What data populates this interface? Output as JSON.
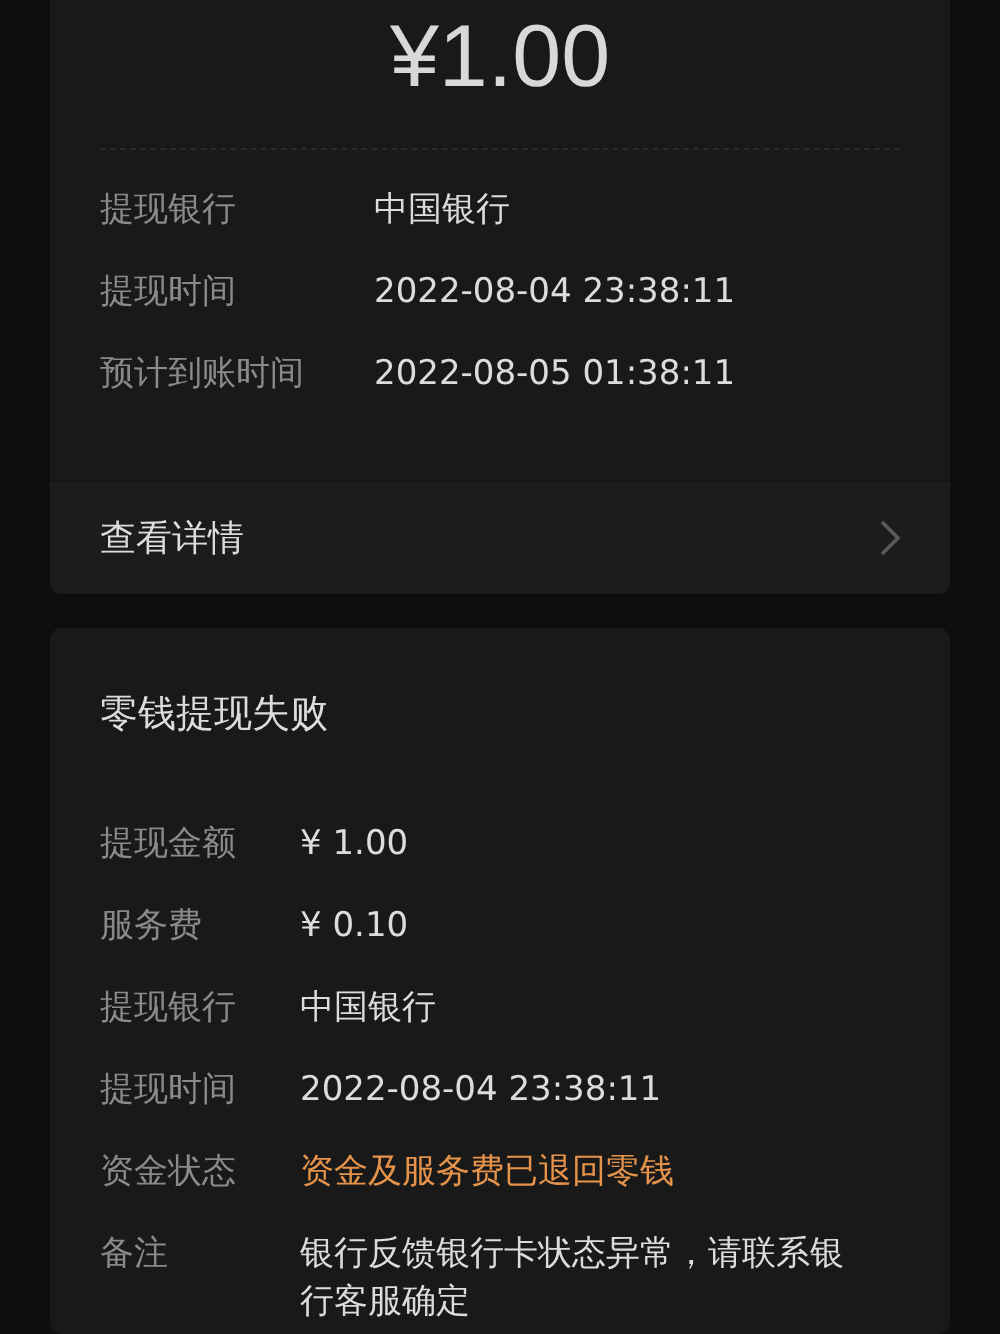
{
  "summary": {
    "amount": "¥1.00",
    "rows": [
      {
        "label": "提现银行",
        "value": "中国银行",
        "kind": "plain"
      },
      {
        "label": "提现时间",
        "value": "2022-08-04 23:38:11",
        "kind": "plain"
      },
      {
        "label": "预计到账时间",
        "value": "2022-08-05 01:38:11",
        "kind": "plain"
      }
    ],
    "details_link": "查看详情"
  },
  "failure": {
    "title": "零钱提现失败",
    "rows": [
      {
        "label": "提现金额",
        "value": "¥ 1.00",
        "kind": "plain"
      },
      {
        "label": "服务费",
        "value": "¥ 0.10",
        "kind": "plain"
      },
      {
        "label": "提现银行",
        "value": "中国银行",
        "kind": "plain"
      },
      {
        "label": "提现时间",
        "value": "2022-08-04 23:38:11",
        "kind": "plain"
      },
      {
        "label": "资金状态",
        "value": "资金及服务费已退回零钱",
        "kind": "alert"
      },
      {
        "label": "备注",
        "value": "银行反馈银行卡状态异常，请联系银行客服确定",
        "kind": "plain"
      }
    ]
  }
}
